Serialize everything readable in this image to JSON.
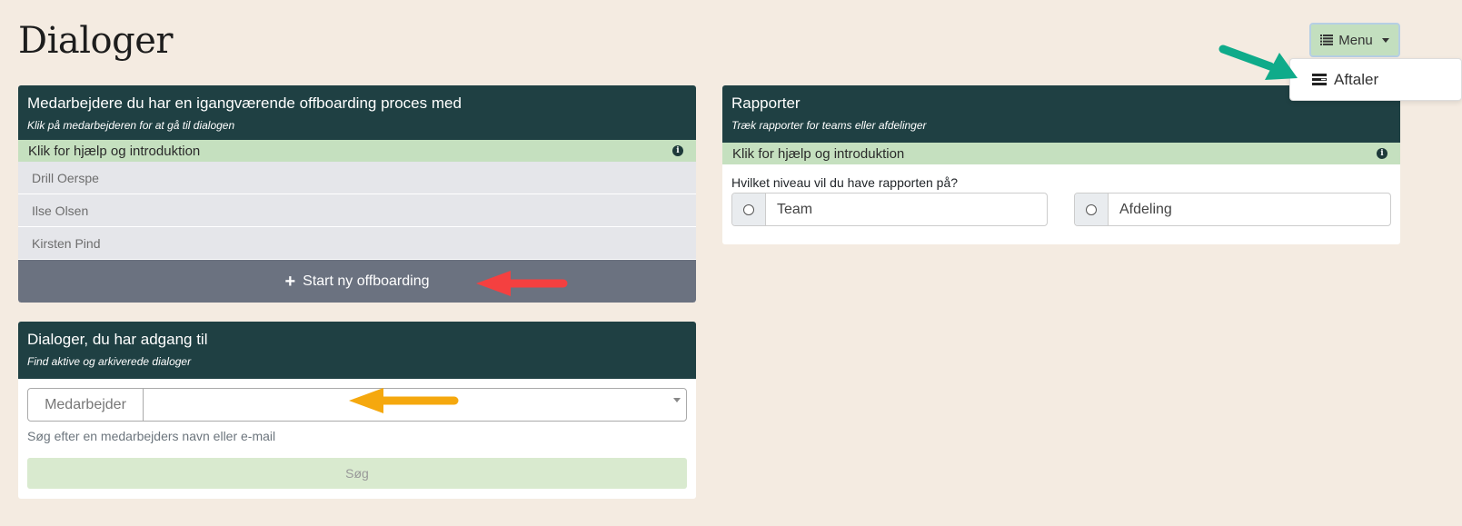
{
  "page": {
    "title": "Dialoger"
  },
  "menu": {
    "button_label": "Menu",
    "button_icon": "list-icon",
    "dropdown_items": [
      {
        "label": "Aftaler",
        "icon": "agreements-icon"
      }
    ]
  },
  "offboarding_card": {
    "title": "Medarbejdere du har en igangværende offboarding proces med",
    "subtitle": "Klik på medarbejderen for at gå til dialogen",
    "help_label": "Klik for hjælp og introduktion",
    "help_icon": "info-icon",
    "employees": [
      {
        "name": "Drill Oerspe"
      },
      {
        "name": "Ilse Olsen"
      },
      {
        "name": "Kirsten Pind"
      }
    ],
    "start_button_label": "Start ny offboarding",
    "start_button_icon": "plus-icon"
  },
  "dialogs_card": {
    "title": "Dialoger, du har adgang til",
    "subtitle": "Find aktive og arkiverede dialoger",
    "field_label": "Medarbejder",
    "field_value": "",
    "hint": "Søg efter en medarbejders navn eller e-mail",
    "search_button_label": "Søg"
  },
  "reports_card": {
    "title": "Rapporter",
    "subtitle": "Træk rapporter for teams eller afdelinger",
    "help_label": "Klik for hjælp og introduktion",
    "question": "Hvilket niveau vil du have rapporten på?",
    "options": [
      {
        "label": "Team",
        "selected": false
      },
      {
        "label": "Afdeling",
        "selected": false
      }
    ]
  },
  "annotations": {
    "red_arrow_color": "#f44040",
    "orange_arrow_color": "#f5a80e",
    "green_arrow_color": "#0fab8a"
  },
  "colors": {
    "background": "#f4ebe1",
    "card_header": "#1f4043",
    "help_bar": "#c5e0bf",
    "start_button": "#6b7280"
  }
}
